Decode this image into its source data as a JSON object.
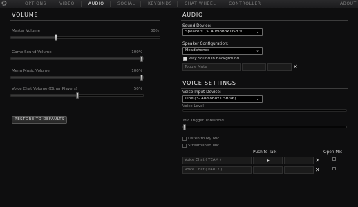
{
  "nav": {
    "tabs": [
      {
        "label": "OPTIONS"
      },
      {
        "label": "VIDEO"
      },
      {
        "label": "AUDIO"
      },
      {
        "label": "SOCIAL"
      },
      {
        "label": "KEYBINDS"
      },
      {
        "label": "CHAT WHEEL"
      },
      {
        "label": "CONTROLLER"
      }
    ],
    "about_label": "ABOUT",
    "active_tab": "AUDIO"
  },
  "volume": {
    "title": "VOLUME",
    "sliders": [
      {
        "label": "Master Volume",
        "value_text": "30%",
        "level": 0.3
      },
      {
        "label": "Game Sound Volume",
        "value_text": "100%",
        "level": 1.0
      },
      {
        "label": "Menu Music Volume",
        "value_text": "100%",
        "level": 1.0
      },
      {
        "label": "Voice Chat Volume (Other Players)",
        "value_text": "50%",
        "level": 0.5
      }
    ],
    "restore_label": "RESTORE TO DEFAULTS"
  },
  "audio": {
    "title": "AUDIO",
    "sound_device_label": "Sound Device:",
    "sound_device_value": "Speakers (3- AudioBox USB 9...",
    "speaker_config_label": "Speaker Configuration:",
    "speaker_config_value": "Headphones",
    "play_in_background_label": "Play Sound in Background",
    "play_in_background_checked": true,
    "toggle_mute_label": "Toggle Mute"
  },
  "voice": {
    "title": "VOICE SETTINGS",
    "input_device_label": "Voice Input Device:",
    "input_device_value": "Line (3- AudioBox USB 96)",
    "voice_level_label": "Voice Level",
    "voice_level": 0.0,
    "mic_threshold_label": "Mic Trigger Threshold",
    "mic_threshold_level": 0.0,
    "listen_label": "Listen to My Mic",
    "listen_checked": false,
    "streamlined_label": "Streamlined Mic",
    "streamlined_checked": false,
    "ptt_header": "Push to Talk",
    "open_mic_header": "Open Mic",
    "rows": [
      {
        "label": "Voice Chat ( TEAM )",
        "open_mic": false
      },
      {
        "label": "Voice Chat ( PARTY )",
        "open_mic": false
      }
    ]
  },
  "colors": {
    "background": "#0e0e0f",
    "active_tab": "#f0f0f0",
    "inactive_tab": "#7c7c7c"
  },
  "icons": {
    "settings": "gear-icon",
    "dropdown": "chevron-down-icon",
    "clear": "close-icon"
  }
}
